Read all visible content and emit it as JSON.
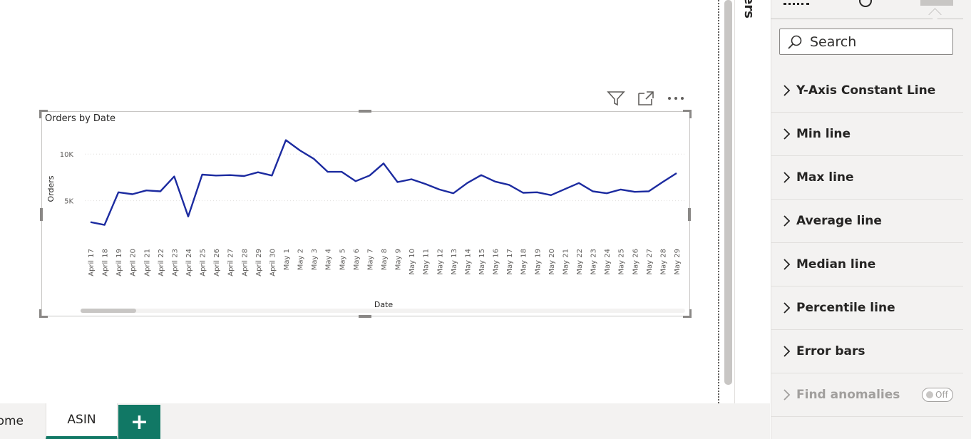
{
  "canvas": {
    "visual": {
      "title": "Orders by Date",
      "header_icons": [
        "filter-icon",
        "focus-mode-icon",
        "more-options-icon"
      ]
    }
  },
  "chart_data": {
    "type": "line",
    "title": "Orders by Date",
    "xlabel": "Date",
    "ylabel": "Orders",
    "y_ticks": [
      "5K",
      "10K"
    ],
    "ylim": [
      0,
      13000
    ],
    "grid": true,
    "color": "#1c2ba0",
    "categories": [
      "April 17",
      "April 18",
      "April 19",
      "April 20",
      "April 21",
      "April 22",
      "April 23",
      "April 24",
      "April 25",
      "April 26",
      "April 27",
      "April 28",
      "April 29",
      "April 30",
      "May 1",
      "May 2",
      "May 3",
      "May 4",
      "May 5",
      "May 6",
      "May 7",
      "May 8",
      "May 9",
      "May 10",
      "May 11",
      "May 12",
      "May 13",
      "May 14",
      "May 15",
      "May 16",
      "May 17",
      "May 18",
      "May 19",
      "May 20",
      "May 21",
      "May 22",
      "May 23",
      "May 24",
      "May 25",
      "May 26",
      "May 27",
      "May 28",
      "May 29"
    ],
    "series": [
      {
        "values": [
          2700,
          2400,
          5900,
          5700,
          6100,
          6000,
          7600,
          3300,
          7800,
          7700,
          7750,
          7650,
          8050,
          7700,
          11500,
          10400,
          9500,
          8100,
          8100,
          7100,
          7700,
          9000,
          7000,
          7300,
          6800,
          6200,
          5800,
          6900,
          7750,
          7050,
          6700,
          5850,
          5900,
          5600,
          6250,
          6900,
          6000,
          5800,
          6200,
          5950,
          6000,
          7000,
          7950
        ]
      }
    ]
  },
  "side_collapsed_label": "ers",
  "format_pane": {
    "search_placeholder": "Search",
    "sections": [
      {
        "label": "Y-Axis Constant Line"
      },
      {
        "label": "Min line"
      },
      {
        "label": "Max line"
      },
      {
        "label": "Average line"
      },
      {
        "label": "Median line"
      },
      {
        "label": "Percentile line"
      },
      {
        "label": "Error bars"
      },
      {
        "label": "Find anomalies",
        "toggle": "Off"
      }
    ]
  },
  "tabs": {
    "items": [
      "ome",
      "ASIN"
    ],
    "add_label": "+",
    "active_color": "#117865"
  }
}
